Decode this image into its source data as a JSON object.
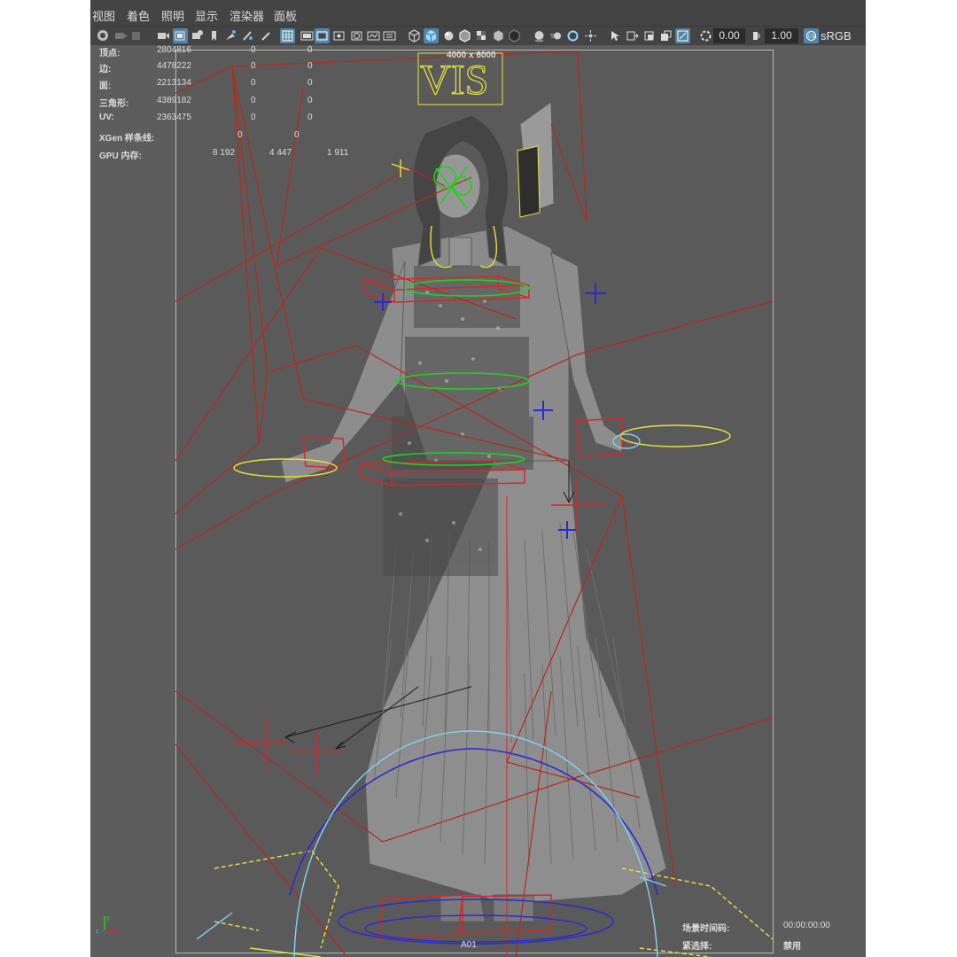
{
  "menubar": {
    "items": [
      "视图",
      "着色",
      "照明",
      "显示",
      "渲染器",
      "面板"
    ]
  },
  "toolbar": {
    "field1": "0.00",
    "field2": "1.00",
    "colorspace": "sRGB ga"
  },
  "hud_stats": {
    "rows": [
      {
        "label": "顶点:",
        "value": "2804816",
        "selected": "0",
        "components": "0"
      },
      {
        "label": "边:",
        "value": "4478222",
        "selected": "0",
        "components": "0"
      },
      {
        "label": "面:",
        "value": "2213134",
        "selected": "0",
        "components": "0"
      },
      {
        "label": "三角形:",
        "value": "4389182",
        "selected": "0",
        "components": "0"
      },
      {
        "label": "UV:",
        "value": "2363475",
        "selected": "0",
        "components": "0"
      }
    ],
    "xgen_label": "XGen 样条线:",
    "xgen_values": [
      "0",
      "0"
    ],
    "gpu_label": "GPU 内存:",
    "gpu_values": [
      "8 192",
      "4 447",
      "1 911"
    ]
  },
  "resolution_gate": "4000 x 6000",
  "camera_name": "A01",
  "hud_bottom": {
    "timecode_label": "场景时间码:",
    "timecode_value": "00:00:00:00",
    "lock_label": "紧选择:",
    "lock_value": "禁用"
  },
  "axis": {
    "x": "x",
    "y": "y",
    "z": "z"
  },
  "colors": {
    "viewport_bg": "#5d5d5d",
    "menubar_bg": "#444444",
    "active_button": "#5285a6",
    "rig_red": "#b52a1a",
    "curve_yellow": "#e8e33a",
    "locator_blue": "#2a2ad6",
    "joint_green": "#1fd21f",
    "circle_cyan": "#7fd3f5"
  },
  "icons": [
    "select-tool-icon",
    "camera-icon",
    "grid-icon",
    "wireframe-icon",
    "smooth-shade-icon",
    "texture-icon",
    "light-icon",
    "shadow-icon",
    "isolate-icon",
    "xray-icon",
    "gate-icon",
    "exposure-icon",
    "gamma-icon",
    "color-management-icon"
  ]
}
